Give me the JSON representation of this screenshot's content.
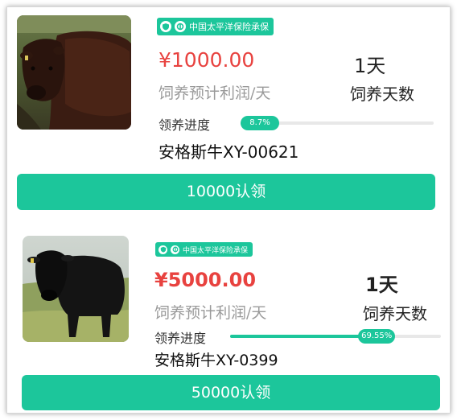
{
  "colors": {
    "accent": "#1cc69b",
    "price_red": "#e8423f"
  },
  "listings": [
    {
      "insurance_badge": "中国太平洋保险承保",
      "price": "¥1000.00",
      "profit_label": "饲养预计利润/天",
      "days": "1天",
      "days_label": "饲养天数",
      "progress_label": "领养进度",
      "progress_percent": 8.7,
      "progress_text": "8.7%",
      "name": "安格斯牛XY-00621",
      "adopt_button": "10000认领"
    },
    {
      "insurance_badge": "中国太平洋保险承保",
      "price": "¥5000.00",
      "profit_label": "饲养预计利润/天",
      "days": "1天",
      "days_label": "饲养天数",
      "progress_label": "领养进度",
      "progress_percent": 69.55,
      "progress_text": "69.55%",
      "name": "安格斯牛XY-0399",
      "adopt_button": "50000认领"
    }
  ]
}
